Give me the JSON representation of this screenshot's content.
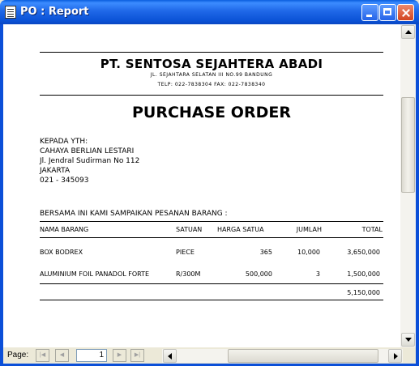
{
  "window": {
    "title": "PO : Report"
  },
  "report": {
    "company_name": "PT. SENTOSA SEJAHTERA ABADI",
    "address": "JL. SEJAHTARA SELATAN III NO.99 BANDUNG",
    "phone": "TELP: 022-7838304 FAX: 022-7838340",
    "doc_title": "PURCHASE ORDER",
    "recipient": {
      "heading": "KEPADA YTH:",
      "name": "CAHAYA BERLIAN LESTARI",
      "street": "Jl. Jendral Sudirman No 112",
      "city": "JAKARTA",
      "phone": "021 - 345093"
    },
    "intro": "BERSAMA INI KAMI SAMPAIKAN PESANAN BARANG :",
    "table": {
      "headers": [
        "NAMA BARANG",
        "SATUAN",
        "HARGA SATUA",
        "JUMLAH",
        "TOTAL"
      ],
      "rows": [
        [
          "BOX BODREX",
          "PIECE",
          "365",
          "10,000",
          "3,650,000"
        ],
        [
          "ALUMINIUM FOIL PANADOL FORTE",
          "R/300M",
          "500,000",
          "3",
          "1,500,000"
        ]
      ],
      "grand_total": "5,150,000"
    }
  },
  "navigation": {
    "page_label": "Page:",
    "page_number": "1"
  }
}
